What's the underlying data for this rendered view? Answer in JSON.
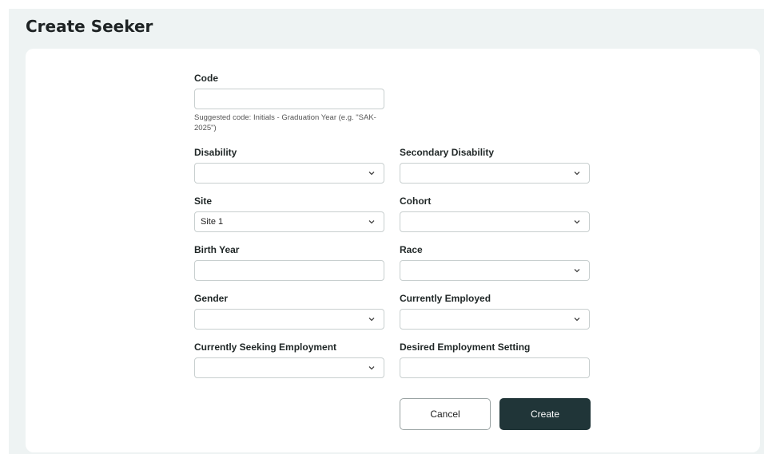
{
  "page": {
    "title": "Create Seeker"
  },
  "form": {
    "code": {
      "label": "Code",
      "value": "",
      "hint": "Suggested code: Initials - Graduation Year (e.g. \"SAK-2025\")"
    },
    "disability": {
      "label": "Disability",
      "value": ""
    },
    "secondary_disability": {
      "label": "Secondary Disability",
      "value": ""
    },
    "site": {
      "label": "Site",
      "value": "Site 1"
    },
    "cohort": {
      "label": "Cohort",
      "value": ""
    },
    "birth_year": {
      "label": "Birth Year",
      "value": ""
    },
    "race": {
      "label": "Race",
      "value": ""
    },
    "gender": {
      "label": "Gender",
      "value": ""
    },
    "currently_employed": {
      "label": "Currently Employed",
      "value": ""
    },
    "currently_seeking": {
      "label": "Currently Seeking Employment",
      "value": ""
    },
    "desired_setting": {
      "label": "Desired Employment Setting",
      "value": ""
    }
  },
  "actions": {
    "cancel_label": "Cancel",
    "create_label": "Create"
  },
  "icons": {
    "dropdown": "chevron-down-icon"
  },
  "colors": {
    "primary_button": "#203538",
    "frame_background": "#eef3f3"
  }
}
